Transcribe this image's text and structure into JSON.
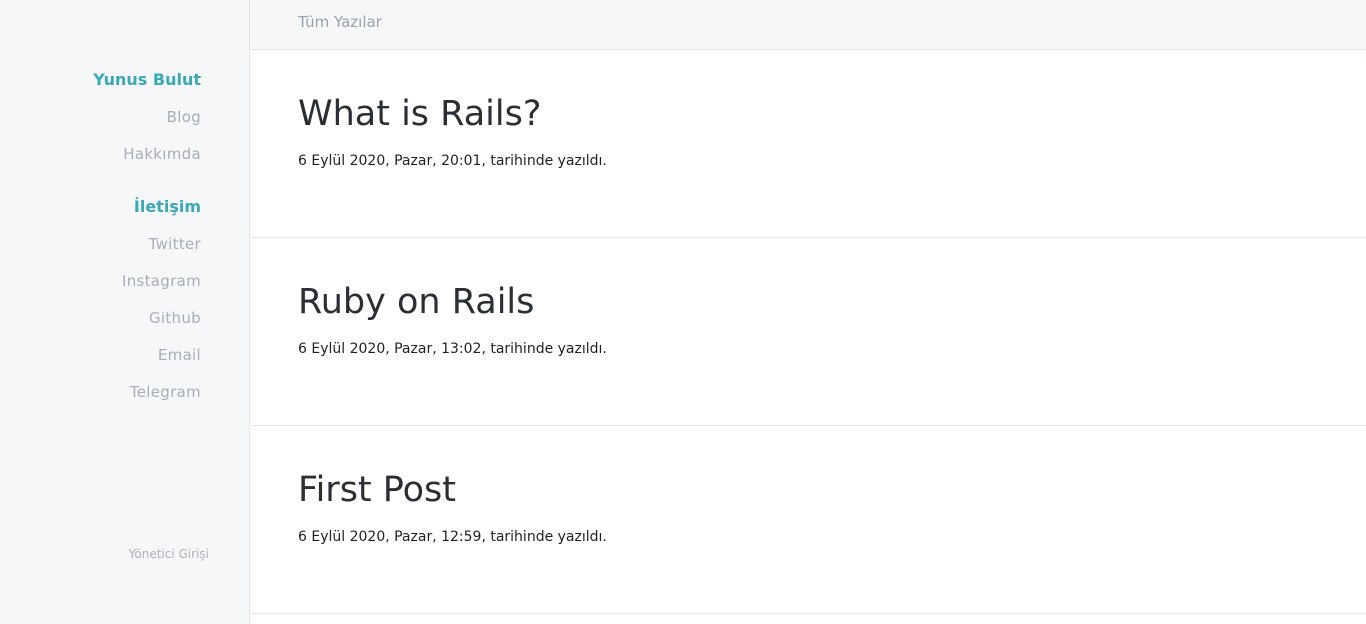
{
  "sidebar": {
    "brand": {
      "heading": "Yunus Bulut",
      "items": [
        {
          "label": "Blog"
        },
        {
          "label": "Hakkımda"
        }
      ]
    },
    "contact": {
      "heading": "İletişim",
      "items": [
        {
          "label": "Twitter"
        },
        {
          "label": "Instagram"
        },
        {
          "label": "Github"
        },
        {
          "label": "Email"
        },
        {
          "label": "Telegram"
        }
      ]
    },
    "admin_label": "Yönetici Girişi"
  },
  "topbar": {
    "link_label": "Tüm Yazılar"
  },
  "posts": [
    {
      "title": "What is Rails?",
      "meta": "6 Eylül 2020, Pazar, 20:01, tarihinde yazıldı."
    },
    {
      "title": "Ruby on Rails",
      "meta": "6 Eylül 2020, Pazar, 13:02, tarihinde yazıldı."
    },
    {
      "title": "First Post",
      "meta": "6 Eylül 2020, Pazar, 12:59, tarihinde yazıldı."
    }
  ],
  "colors": {
    "accent": "#3aa8b5",
    "muted_link": "#a8afb9",
    "sidebar_bg": "#f5f7f9",
    "title_text": "#2a2f36"
  }
}
